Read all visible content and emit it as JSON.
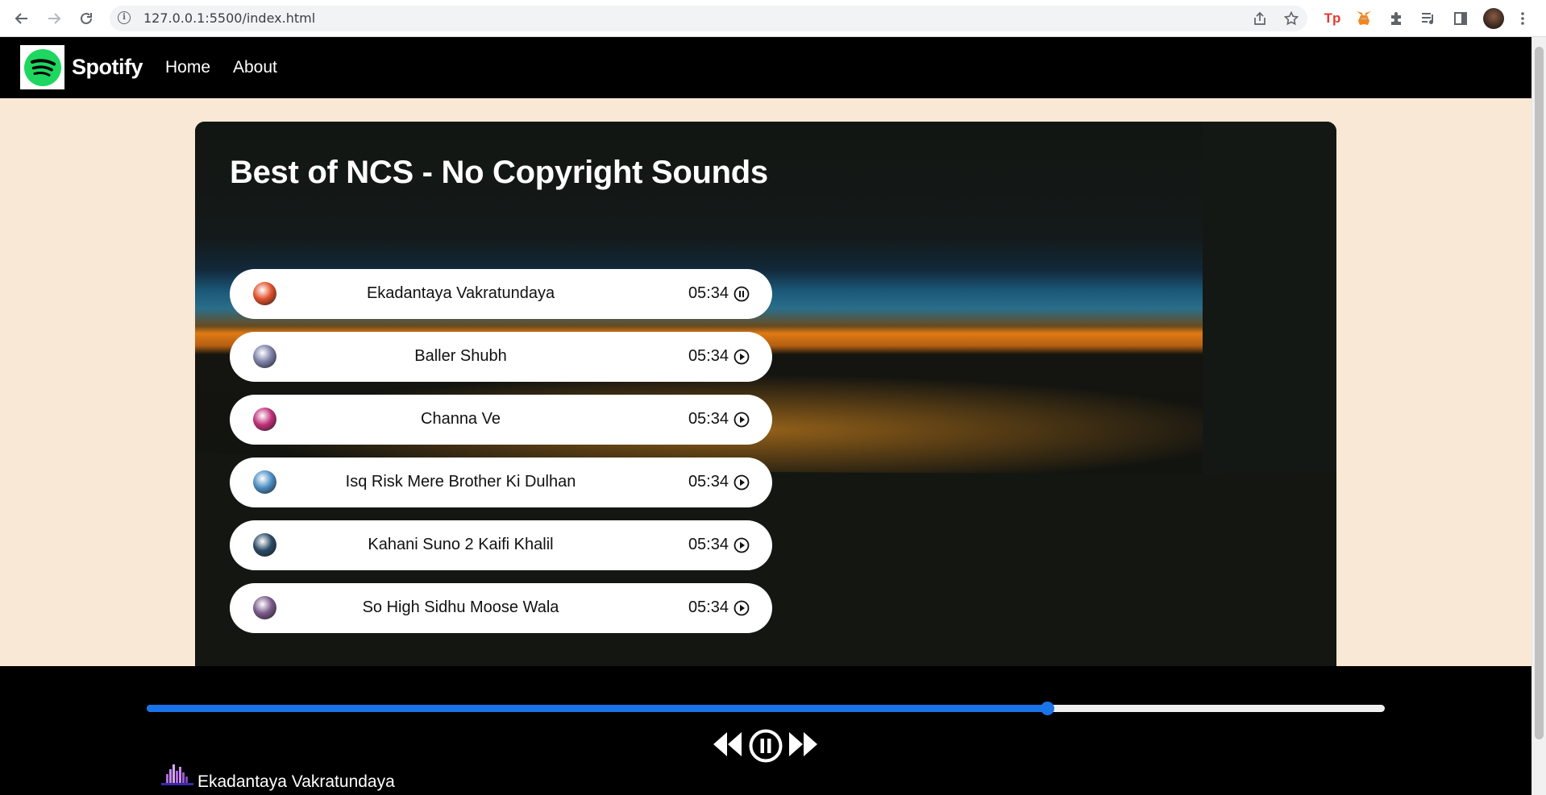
{
  "browser": {
    "url": "127.0.0.1:5500/index.html",
    "back_icon": "arrow-left-icon",
    "forward_icon": "arrow-right-icon",
    "reload_icon": "reload-icon",
    "extensions": [
      "Tp",
      "metamask-fox-icon",
      "puzzle-icon",
      "media-queue-icon",
      "side-panel-icon"
    ]
  },
  "nav": {
    "brand": "Spotify",
    "links": [
      "Home",
      "About"
    ]
  },
  "playlist": {
    "title": "Best of NCS - No Copyright Sounds",
    "songs": [
      {
        "name": "Ekadantaya Vakratundaya",
        "duration": "05:34",
        "state": "pause",
        "thumb_color": "#e0502a"
      },
      {
        "name": "Baller Shubh",
        "duration": "05:34",
        "state": "play",
        "thumb_color": "#7b7fa6"
      },
      {
        "name": "Channa Ve",
        "duration": "05:34",
        "state": "play",
        "thumb_color": "#c0307a"
      },
      {
        "name": "Isq Risk Mere Brother Ki Dulhan",
        "duration": "05:34",
        "state": "play",
        "thumb_color": "#4d8fc4"
      },
      {
        "name": "Kahani Suno 2 Kaifi Khalil",
        "duration": "05:34",
        "state": "play",
        "thumb_color": "#2b4a66"
      },
      {
        "name": "So High Sidhu Moose Wala",
        "duration": "05:34",
        "state": "play",
        "thumb_color": "#7a5a8c"
      }
    ]
  },
  "player": {
    "progress_percent": 72.7,
    "now_playing": "Ekadantaya Vakratundaya",
    "accent_color": "#1a73e8",
    "controls": [
      "previous-icon",
      "pause-circle-icon",
      "next-icon"
    ]
  }
}
